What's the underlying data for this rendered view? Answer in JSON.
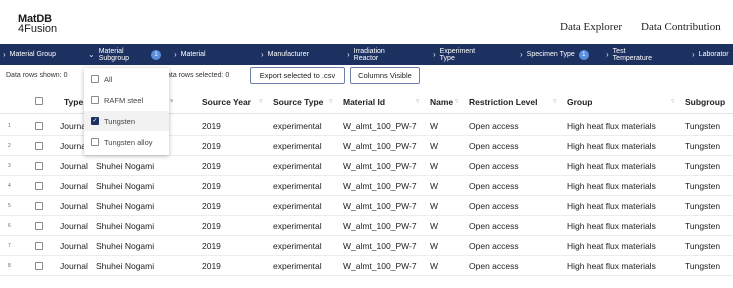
{
  "logo": {
    "line1": "MatDB",
    "line2": "4Fusion"
  },
  "nav": {
    "explorer": "Data Explorer",
    "contribution": "Data Contribution"
  },
  "filters": [
    {
      "label": "Material Group",
      "twoline": false,
      "badge": ""
    },
    {
      "label": "Material\nSubgroup",
      "twoline": true,
      "badge": "1"
    },
    {
      "label": "Material",
      "twoline": false,
      "badge": ""
    },
    {
      "label": "Manufacturer",
      "twoline": false,
      "badge": ""
    },
    {
      "label": "Irradiation\nReactor",
      "twoline": true,
      "badge": ""
    },
    {
      "label": "Experiment\nType",
      "twoline": true,
      "badge": ""
    },
    {
      "label": "Specimen Type",
      "twoline": false,
      "badge": "1"
    },
    {
      "label": "Test\nTemperature",
      "twoline": true,
      "badge": ""
    },
    {
      "label": "Laborator",
      "twoline": false,
      "badge": ""
    }
  ],
  "status": {
    "rows_shown": "Data rows shown: 0",
    "rows_selected": "ata rows selected: 0",
    "export_button": "Export selected to .csv",
    "columns_button": "Columns Visible"
  },
  "columns": [
    "Type",
    "Source Year",
    "Source Type",
    "Material Id",
    "Name",
    "Restriction Level",
    "Group",
    "Subgroup"
  ],
  "dropdown": {
    "options": [
      {
        "label": "All",
        "checked": false
      },
      {
        "label": "RAFM steel",
        "checked": false
      },
      {
        "label": "Tungsten",
        "checked": true
      },
      {
        "label": "Tungsten alloy",
        "checked": false
      }
    ]
  },
  "rows": [
    {
      "num": "1",
      "type": "Journal",
      "author": "",
      "year": "2019",
      "source_type": "experimental",
      "material_id": "W_almt_100_PW-7",
      "name": "W",
      "restriction": "Open access",
      "group": "High heat flux materials",
      "subgroup": "Tungsten"
    },
    {
      "num": "2",
      "type": "Journal",
      "author": "",
      "year": "2019",
      "source_type": "experimental",
      "material_id": "W_almt_100_PW-7",
      "name": "W",
      "restriction": "Open access",
      "group": "High heat flux materials",
      "subgroup": "Tungsten"
    },
    {
      "num": "3",
      "type": "Journal",
      "author": "Shuhei Nogami",
      "year": "2019",
      "source_type": "experimental",
      "material_id": "W_almt_100_PW-7",
      "name": "W",
      "restriction": "Open access",
      "group": "High heat flux materials",
      "subgroup": "Tungsten"
    },
    {
      "num": "4",
      "type": "Journal",
      "author": "Shuhei Nogami",
      "year": "2019",
      "source_type": "experimental",
      "material_id": "W_almt_100_PW-7",
      "name": "W",
      "restriction": "Open access",
      "group": "High heat flux materials",
      "subgroup": "Tungsten"
    },
    {
      "num": "5",
      "type": "Journal",
      "author": "Shuhei Nogami",
      "year": "2019",
      "source_type": "experimental",
      "material_id": "W_almt_100_PW-7",
      "name": "W",
      "restriction": "Open access",
      "group": "High heat flux materials",
      "subgroup": "Tungsten"
    },
    {
      "num": "6",
      "type": "Journal",
      "author": "Shuhei Nogami",
      "year": "2019",
      "source_type": "experimental",
      "material_id": "W_almt_100_PW-7",
      "name": "W",
      "restriction": "Open access",
      "group": "High heat flux materials",
      "subgroup": "Tungsten"
    },
    {
      "num": "7",
      "type": "Journal",
      "author": "Shuhei Nogami",
      "year": "2019",
      "source_type": "experimental",
      "material_id": "W_almt_100_PW-7",
      "name": "W",
      "restriction": "Open access",
      "group": "High heat flux materials",
      "subgroup": "Tungsten"
    },
    {
      "num": "8",
      "type": "Journal",
      "author": "Shuhei Nogami",
      "year": "2019",
      "source_type": "experimental",
      "material_id": "W_almt_100_PW-7",
      "name": "W",
      "restriction": "Open access",
      "group": "High heat flux materials",
      "subgroup": "Tungsten"
    }
  ]
}
